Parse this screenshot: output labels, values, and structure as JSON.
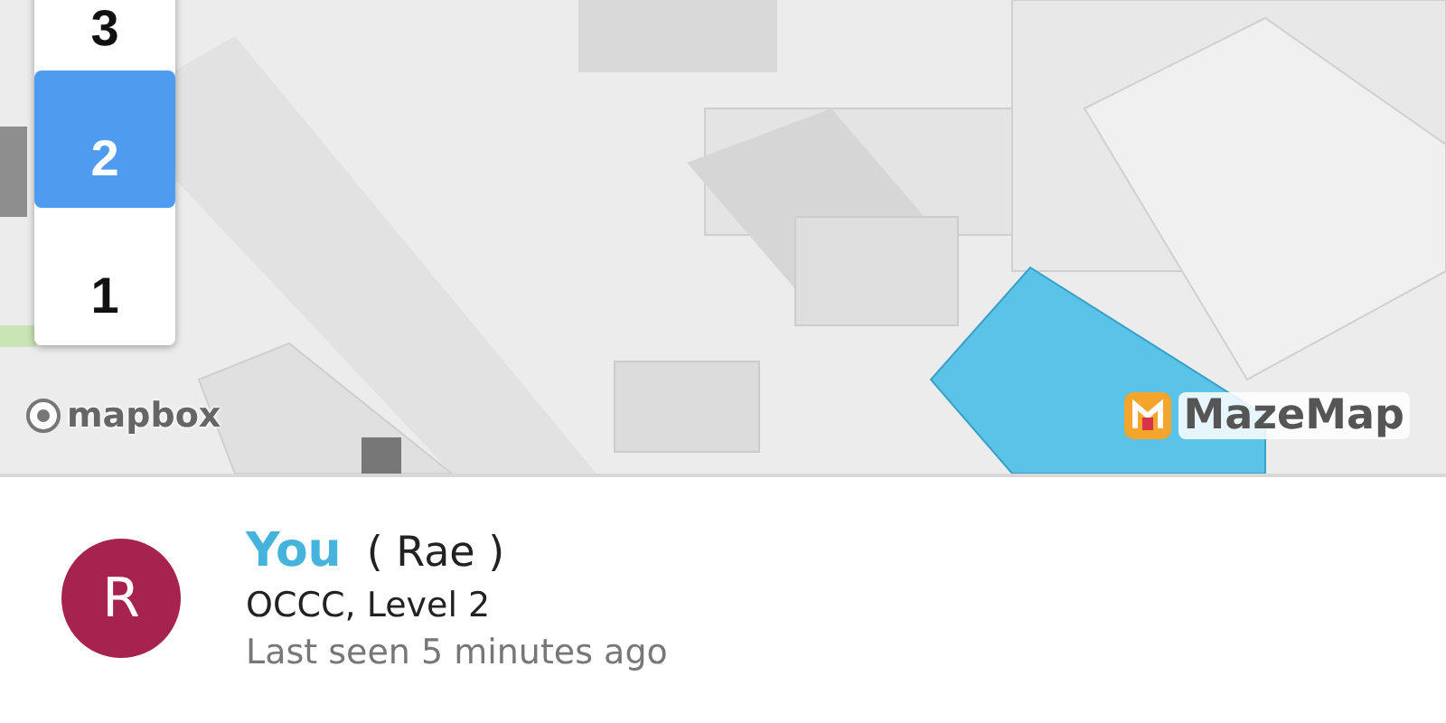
{
  "floors": [
    {
      "label": "3",
      "selected": false
    },
    {
      "label": "2",
      "selected": true
    },
    {
      "label": "1",
      "selected": false
    }
  ],
  "attribution": [
    {
      "kind": "mapbox",
      "text": "mapbox"
    },
    {
      "kind": "mazemap",
      "text": "MazeMap"
    }
  ],
  "person": {
    "initial": "R",
    "name": "You",
    "nickname": "( Rae )",
    "location": "OCCC, Level 2",
    "last_seen": "Last seen 5 minutes ago"
  }
}
